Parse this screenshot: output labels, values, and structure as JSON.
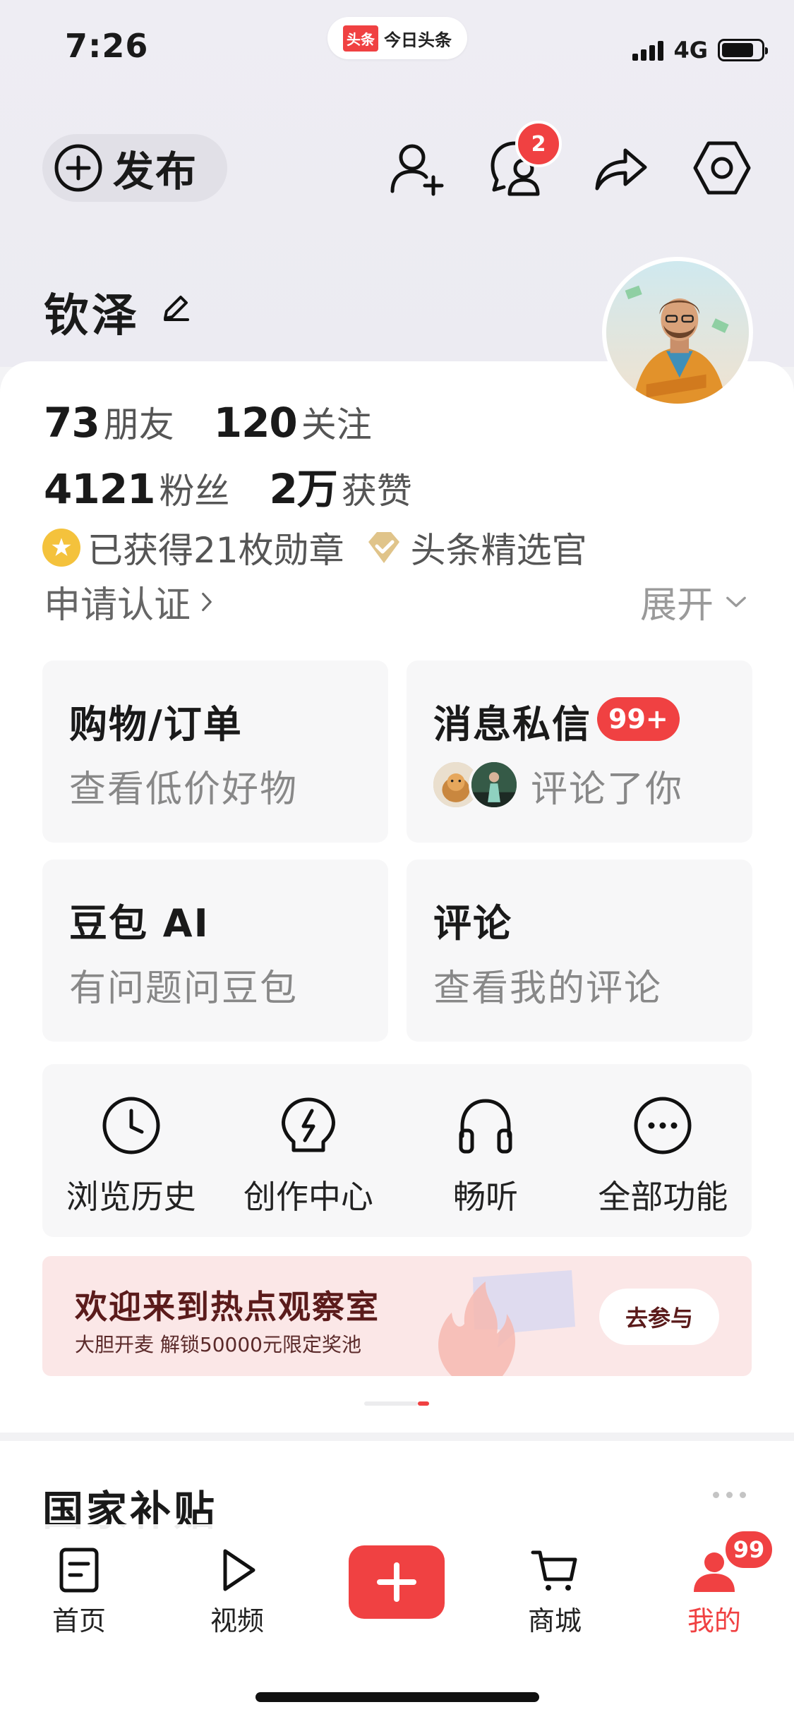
{
  "status_bar": {
    "time": "7:26",
    "app_badge": "头条",
    "app_name": "今日头条",
    "network": "4G",
    "battery_level": 0.82
  },
  "header": {
    "publish_label": "发布",
    "message_badge": "2"
  },
  "profile": {
    "name": "钦泽"
  },
  "stats": {
    "friends": {
      "value": "73",
      "label": "朋友"
    },
    "following": {
      "value": "120",
      "label": "关注"
    },
    "fans": {
      "value": "4121",
      "label": "粉丝"
    },
    "likes": {
      "value": "2万",
      "label": "获赞"
    }
  },
  "honors": {
    "medals": "已获得21枚勋章",
    "title": "头条精选官"
  },
  "verify_label": "申请认证",
  "expand_label": "展开",
  "tiles": {
    "shopping": {
      "title": "购物/订单",
      "subtitle": "查看低价好物"
    },
    "messages": {
      "title": "消息私信",
      "badge": "99+",
      "subtitle": "评论了你"
    },
    "doubao": {
      "title": "豆包 AI",
      "subtitle": "有问题问豆包"
    },
    "comments": {
      "title": "评论",
      "subtitle": "查看我的评论"
    }
  },
  "tools": [
    {
      "label": "浏览历史",
      "icon": "clock-icon"
    },
    {
      "label": "创作中心",
      "icon": "lightning-bulb-icon"
    },
    {
      "label": "畅听",
      "icon": "headphones-icon"
    },
    {
      "label": "全部功能",
      "icon": "more-circle-icon"
    }
  ],
  "banner": {
    "title": "欢迎来到热点观察室",
    "subtitle": "大胆开麦 解锁50000元限定奖池",
    "button": "去参与"
  },
  "pager": {
    "total": 2,
    "active": 2
  },
  "section": {
    "title": "国家补贴"
  },
  "tabbar": {
    "items": [
      {
        "label": "首页",
        "icon": "document-icon"
      },
      {
        "label": "视频",
        "icon": "play-icon"
      },
      {
        "label": "",
        "icon": "plus-icon"
      },
      {
        "label": "商城",
        "icon": "cart-icon"
      },
      {
        "label": "我的",
        "icon": "person-icon",
        "badge": "99"
      }
    ]
  },
  "colors": {
    "accent": "#f04142",
    "medal": "#f4c23c",
    "banner_bg": "#fbe7e7"
  }
}
